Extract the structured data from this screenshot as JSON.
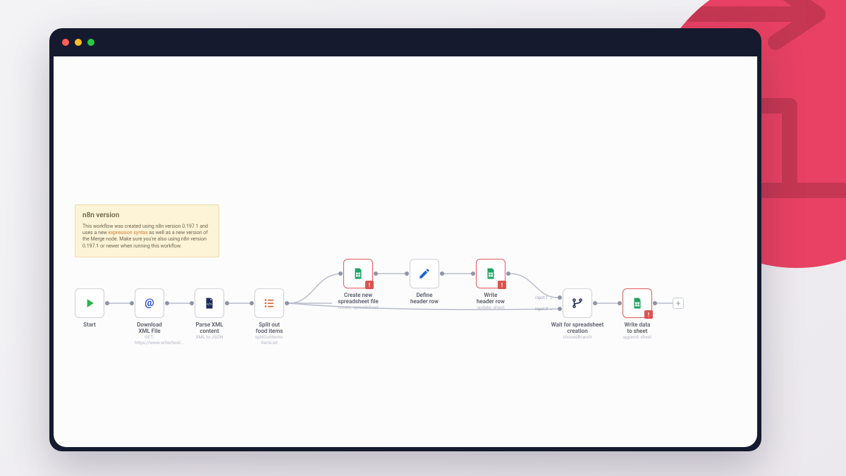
{
  "note": {
    "title": "n8n version",
    "body_pre": "This workflow was created using n8n version 0.197.1 and uses a new ",
    "link": "expression syntax",
    "body_post": " as well as a new version of the Merge node. Make sure you're also using n8n version 0.197.1 or newer when running this workflow."
  },
  "merge": {
    "in1": "input 1 →",
    "in2": "input 2 →"
  },
  "nodes": {
    "start": {
      "title": "Start",
      "sub": ""
    },
    "dl": {
      "title": "Download XML File",
      "sub": "GET: https://www.w3school..."
    },
    "parse": {
      "title": "Parse XML content",
      "sub": "XML to JSON"
    },
    "split": {
      "title": "Split out food items",
      "sub": "splitOutItems: itemList"
    },
    "create": {
      "title": "Create new spreadsheet file",
      "sub": "create: spreadsheet"
    },
    "header": {
      "title": "Define header row",
      "sub": ""
    },
    "writeh": {
      "title": "Write header row",
      "sub": "update: sheet"
    },
    "wait": {
      "title": "Wait for spreadsheet creation",
      "sub": "chooseBranch"
    },
    "write": {
      "title": "Write data to sheet",
      "sub": "append: sheet"
    }
  }
}
